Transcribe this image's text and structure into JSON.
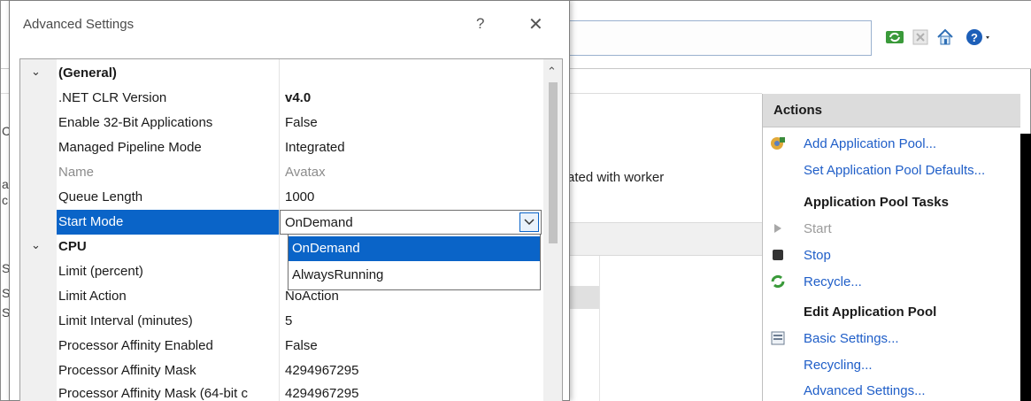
{
  "dialog": {
    "title": "Advanced Settings",
    "help_glyph": "?",
    "close_glyph": "✕"
  },
  "grid": {
    "categories": {
      "general": "(General)",
      "cpu": "CPU"
    },
    "general_rows": [
      {
        "key": ".NET CLR Version",
        "value": "v4.0"
      },
      {
        "key": "Enable 32-Bit Applications",
        "value": "False"
      },
      {
        "key": "Managed Pipeline Mode",
        "value": "Integrated"
      },
      {
        "key": "Name",
        "value": "Avatax"
      },
      {
        "key": "Queue Length",
        "value": "1000"
      },
      {
        "key": "Start Mode",
        "value": "OnDemand"
      }
    ],
    "cpu_rows": [
      {
        "key": "Limit (percent)",
        "value": ""
      },
      {
        "key": "Limit Action",
        "value": "NoAction"
      },
      {
        "key": "Limit Interval (minutes)",
        "value": "5"
      },
      {
        "key": "Processor Affinity Enabled",
        "value": "False"
      },
      {
        "key": "Processor Affinity Mask",
        "value": "4294967295"
      },
      {
        "key": "Processor Affinity Mask (64-bit c",
        "value": "4294967295"
      }
    ],
    "dropdown_options": [
      "OnDemand",
      "AlwaysRunning"
    ]
  },
  "background": {
    "main_text": "ated with worker",
    "left_chars": [
      "C",
      "a",
      "c",
      "S",
      "S",
      "S"
    ]
  },
  "actions": {
    "header": "Actions",
    "add_pool": "Add Application Pool...",
    "set_defaults": "Set Application Pool Defaults...",
    "tasks_header": "Application Pool Tasks",
    "start": "Start",
    "stop": "Stop",
    "recycle": "Recycle...",
    "edit_header": "Edit Application Pool",
    "basic_settings": "Basic Settings...",
    "recycling": "Recycling...",
    "advanced_settings": "Advanced Settings..."
  },
  "colors": {
    "selection": "#0a64c8",
    "link": "#1f5ec8",
    "disabled": "#9b9b9b"
  }
}
